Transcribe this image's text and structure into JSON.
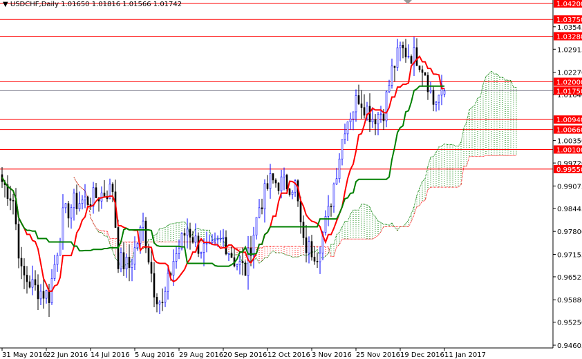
{
  "header": {
    "symbol": "USDCHF,Daily",
    "ohlc": "1.01650 1.01816 1.01566 1.01742"
  },
  "colors": {
    "up": "#0000ff",
    "down": "#000000",
    "tenkan": "#ff0000",
    "kijun": "#008000",
    "cloud_bull": "#008000",
    "cloud_bear": "#ff0000",
    "level": "#ff0000",
    "bid": "#333333"
  },
  "chart_data": {
    "type": "candlestick",
    "title": "USDCHF,Daily",
    "ylim": [
      0.94605,
      1.042
    ],
    "y_ticks": [
      "1.03545",
      "1.02915",
      "1.02270",
      "1.01640",
      "1.00350",
      "0.99720",
      "0.99075",
      "0.98445",
      "0.97800",
      "0.97155",
      "0.96525",
      "0.95880",
      "0.95250",
      "0.94605"
    ],
    "x_ticks": [
      {
        "label": "31 May 2016",
        "index": 0
      },
      {
        "label": "22 Jun 2016",
        "index": 16
      },
      {
        "label": "14 Jul 2016",
        "index": 32
      },
      {
        "label": "5 Aug 2016",
        "index": 48
      },
      {
        "label": "29 Aug 2016",
        "index": 64
      },
      {
        "label": "20 Sep 2016",
        "index": 80
      },
      {
        "label": "12 Oct 2016",
        "index": 96
      },
      {
        "label": "3 Nov 2016",
        "index": 112
      },
      {
        "label": "25 Nov 2016",
        "index": 128
      },
      {
        "label": "19 Dec 2016",
        "index": 144
      },
      {
        "label": "11 Jan 2017",
        "index": 160
      }
    ],
    "close_keypoints": [
      [
        0,
        0.992
      ],
      [
        4,
        0.987
      ],
      [
        7,
        0.966
      ],
      [
        12,
        0.962
      ],
      [
        17,
        0.96
      ],
      [
        22,
        0.982
      ],
      [
        26,
        0.986
      ],
      [
        32,
        0.987
      ],
      [
        40,
        0.99
      ],
      [
        42,
        0.97
      ],
      [
        46,
        0.968
      ],
      [
        51,
        0.98
      ],
      [
        55,
        0.962
      ],
      [
        58,
        0.957
      ],
      [
        62,
        0.97
      ],
      [
        67,
        0.979
      ],
      [
        71,
        0.974
      ],
      [
        75,
        0.972
      ],
      [
        80,
        0.976
      ],
      [
        84,
        0.97
      ],
      [
        88,
        0.967
      ],
      [
        93,
        0.985
      ],
      [
        97,
        0.992
      ],
      [
        106,
        0.991
      ],
      [
        109,
        0.974
      ],
      [
        114,
        0.972
      ],
      [
        118,
        0.983
      ],
      [
        124,
        1.008
      ],
      [
        129,
        1.016
      ],
      [
        134,
        1.01
      ],
      [
        138,
        1.012
      ],
      [
        141,
        1.023
      ],
      [
        144,
        1.029
      ],
      [
        150,
        1.027
      ],
      [
        151,
        1.026
      ],
      [
        153,
        1.023
      ],
      [
        156,
        1.014
      ],
      [
        158,
        1.016
      ],
      [
        160,
        1.01742
      ]
    ],
    "last": {
      "open": 1.0165,
      "high": 1.01816,
      "low": 1.01566,
      "close": 1.01742
    },
    "levels": [
      "1.04200",
      "1.03750",
      "1.03280",
      "1.02000",
      "1.00940",
      "1.00660",
      "1.00100",
      "0.99550"
    ],
    "bid_level": "1.01750",
    "indicators": [
      "Ichimoku Tenkan-sen",
      "Ichimoku Kijun-sen",
      "Senkou Span A",
      "Senkou Span B"
    ]
  }
}
